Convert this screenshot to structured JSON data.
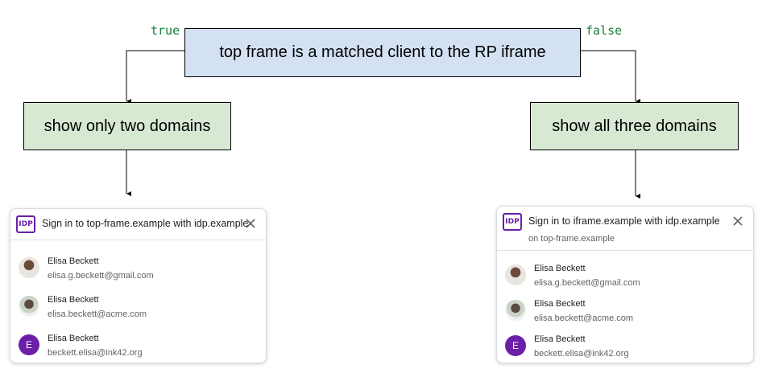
{
  "flowchart": {
    "decision": "top frame is a matched client to the RP iframe",
    "true_label": "true",
    "false_label": "false",
    "left_action": "show only two domains",
    "right_action": "show all three domains"
  },
  "left_dialog": {
    "logo_text": "IDP",
    "title": "Sign in to top-frame.example with idp.example",
    "accounts": [
      {
        "name": "Elisa Beckett",
        "email": "elisa.g.beckett@gmail.com",
        "avatar": "photo"
      },
      {
        "name": "Elisa Beckett",
        "email": "elisa.beckett@acme.com",
        "avatar": "photo"
      },
      {
        "name": "Elisa Beckett",
        "email": "beckett.elisa@ink42.org",
        "avatar": "letter",
        "initial": "E"
      }
    ]
  },
  "right_dialog": {
    "logo_text": "IDP",
    "title": "Sign in to iframe.example with idp.example",
    "subtitle": "on top-frame.example",
    "accounts": [
      {
        "name": "Elisa Beckett",
        "email": "elisa.g.beckett@gmail.com",
        "avatar": "photo"
      },
      {
        "name": "Elisa Beckett",
        "email": "elisa.beckett@acme.com",
        "avatar": "photo"
      },
      {
        "name": "Elisa Beckett",
        "email": "beckett.elisa@ink42.org",
        "avatar": "letter",
        "initial": "E"
      }
    ]
  },
  "colors": {
    "decision_fill": "#d3e1f3",
    "action_fill": "#d7e9d3",
    "branch_label": "#1a7f37",
    "idp_brand": "#6b1fa8"
  }
}
